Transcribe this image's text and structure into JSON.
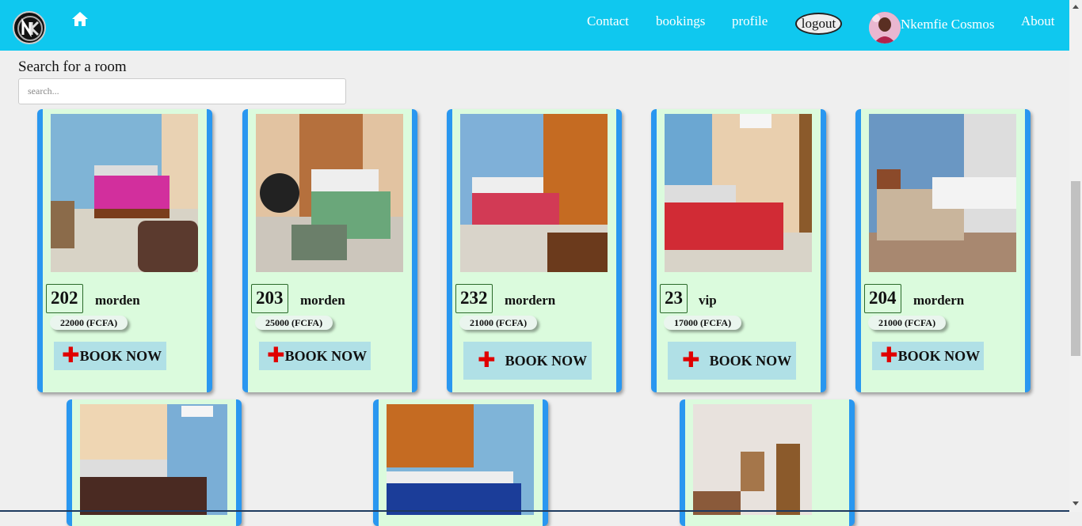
{
  "nav": {
    "contact": "Contact",
    "bookings": "bookings",
    "profile": "profile",
    "logout": "logout",
    "user_name": "Nkemfie Cosmos",
    "about": "About",
    "logo_icon": "nk-logo-icon",
    "home_icon": "home-icon",
    "bg_color": "#0fc8ef"
  },
  "search": {
    "label": "Search for a room",
    "placeholder": "search...",
    "value": ""
  },
  "rooms": [
    {
      "number": "202",
      "type": "morden",
      "price": "22000 (FCFA)",
      "book_label": "BOOK NOW"
    },
    {
      "number": "203",
      "type": "morden",
      "price": "25000 (FCFA)",
      "book_label": "BOOK NOW"
    },
    {
      "number": "232",
      "type": "mordern",
      "price": "21000 (FCFA)",
      "book_label": "BOOK NOW"
    },
    {
      "number": "23",
      "type": "vip",
      "price": "17000 (FCFA)",
      "book_label": "BOOK NOW"
    },
    {
      "number": "204",
      "type": "mordern",
      "price": "21000 (FCFA)",
      "book_label": "BOOK NOW"
    }
  ],
  "colors": {
    "card_bg": "#dbfbdd",
    "card_border": "#2997f0",
    "book_btn_bg": "#b0e0e6",
    "plus_icon": "#e00000"
  }
}
